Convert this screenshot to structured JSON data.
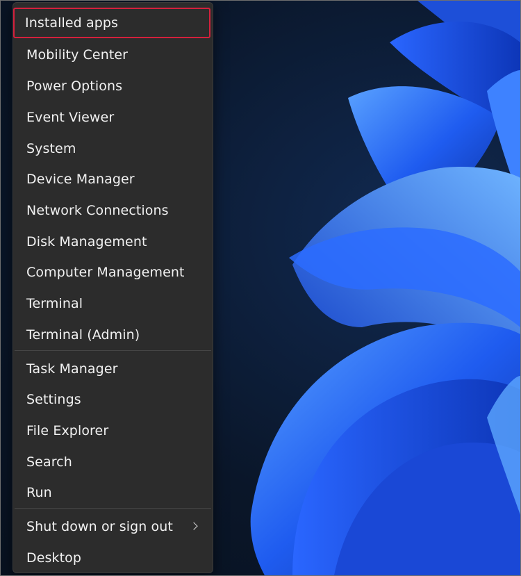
{
  "menu": {
    "items": [
      {
        "label": "Installed apps",
        "highlighted": true
      },
      {
        "label": "Mobility Center"
      },
      {
        "label": "Power Options"
      },
      {
        "label": "Event Viewer"
      },
      {
        "label": "System"
      },
      {
        "label": "Device Manager"
      },
      {
        "label": "Network Connections"
      },
      {
        "label": "Disk Management"
      },
      {
        "label": "Computer Management"
      },
      {
        "label": "Terminal"
      },
      {
        "label": "Terminal (Admin)"
      },
      {
        "label": "Task Manager"
      },
      {
        "label": "Settings"
      },
      {
        "label": "File Explorer"
      },
      {
        "label": "Search"
      },
      {
        "label": "Run"
      },
      {
        "label": "Shut down or sign out",
        "has_submenu": true
      },
      {
        "label": "Desktop"
      }
    ]
  },
  "colors": {
    "menu_bg": "#2c2c2c",
    "text": "#f1f1f1",
    "highlight_border": "#d4203c",
    "wallpaper_accent": "#2f6bff"
  },
  "icons": {
    "submenu": "chevron-right-icon"
  }
}
